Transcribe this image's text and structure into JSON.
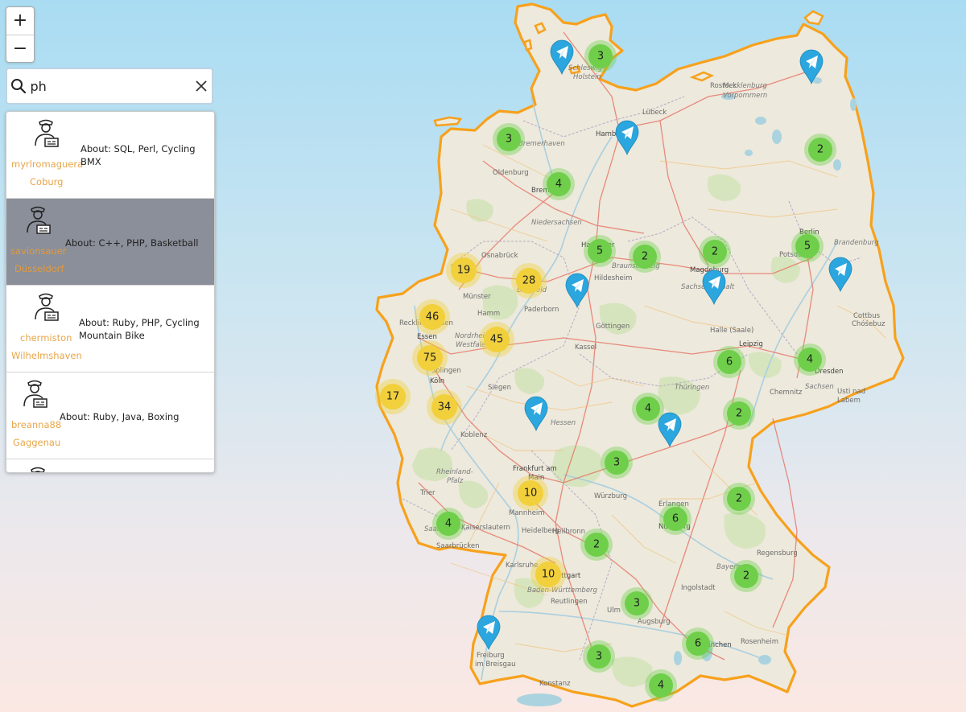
{
  "controls": {
    "zoom_in": "+",
    "zoom_out": "−"
  },
  "search": {
    "value": "ph",
    "icon": "search-icon",
    "clear_icon": "close-icon"
  },
  "results": [
    {
      "username": "myrlromaguera",
      "city": "Coburg",
      "about": "About: SQL, Perl, Cycling BMX",
      "selected": false
    },
    {
      "username": "savionsauer",
      "city": "Düsseldorf",
      "about": "About: C++, PHP, Basketball",
      "selected": true
    },
    {
      "username": "chermiston",
      "city": "Wilhelmshaven",
      "about": "About: Ruby, PHP, Cycling Mountain Bike",
      "selected": false
    },
    {
      "username": "breanna88",
      "city": "Gaggenau",
      "about": "About: Ruby, Java, Boxing",
      "selected": false
    }
  ],
  "map": {
    "country_border_color": "#f7a11c",
    "cluster_small_color": "#6fcf4a",
    "cluster_large_color": "#f1d03c",
    "marker_color": "#2ba6de",
    "marker_icon": "telegram-icon",
    "clusters": [
      {
        "count": "3",
        "size": "small"
      },
      {
        "count": "3",
        "size": "small"
      },
      {
        "count": "4",
        "size": "small"
      },
      {
        "count": "2",
        "size": "small"
      },
      {
        "count": "5",
        "size": "small"
      },
      {
        "count": "2",
        "size": "small"
      },
      {
        "count": "2",
        "size": "small"
      },
      {
        "count": "5",
        "size": "small"
      },
      {
        "count": "19",
        "size": "large"
      },
      {
        "count": "28",
        "size": "large"
      },
      {
        "count": "46",
        "size": "large"
      },
      {
        "count": "45",
        "size": "large"
      },
      {
        "count": "75",
        "size": "large"
      },
      {
        "count": "6",
        "size": "small"
      },
      {
        "count": "4",
        "size": "small"
      },
      {
        "count": "17",
        "size": "large"
      },
      {
        "count": "34",
        "size": "large"
      },
      {
        "count": "4",
        "size": "small"
      },
      {
        "count": "2",
        "size": "small"
      },
      {
        "count": "3",
        "size": "small"
      },
      {
        "count": "10",
        "size": "large"
      },
      {
        "count": "6",
        "size": "small"
      },
      {
        "count": "2",
        "size": "small"
      },
      {
        "count": "4",
        "size": "small"
      },
      {
        "count": "2",
        "size": "small"
      },
      {
        "count": "10",
        "size": "large"
      },
      {
        "count": "2",
        "size": "small"
      },
      {
        "count": "3",
        "size": "small"
      },
      {
        "count": "6",
        "size": "small"
      },
      {
        "count": "3",
        "size": "small"
      },
      {
        "count": "4",
        "size": "small"
      }
    ],
    "labels": [
      "Schleswig-",
      "Holstein",
      "Rostock",
      "Mecklenburg",
      "Vorpommern",
      "Hamb",
      "Lübeck",
      "Bremerhaven",
      "Oldenburg",
      "Bremen",
      "Niedersachsen",
      "Berlin",
      "Potsdam",
      "Brandenburg",
      "Osnabrück",
      "Hannover",
      "Braunschweig",
      "Magdeburg",
      "Sachsen-Anhalt",
      "Hildesheim",
      "Münster",
      "Bielefeld",
      "Paderborn",
      "Hamm",
      "Recklinghausen",
      "Essen",
      "Nordrhein-",
      "Westfalen",
      "Göttingen",
      "Halle (Saale)",
      "Leipzig",
      "Cottbus",
      "Chóśebuz",
      "Dresden",
      "Sachsen",
      "Kassel",
      "Chemnitz",
      "Solingen",
      "Köln",
      "Siegen",
      "Thüringen",
      "Hessen",
      "Koblenz",
      "Frankfurt am",
      "Main",
      "Rheinland-",
      "Pfalz",
      "Trier",
      "Würzburg",
      "Erlangen",
      "Nürnberg",
      "Mannheim",
      "Heidelberg",
      "Kaiserslautern",
      "Saarland",
      "Saarbrücken",
      "Heilbronn",
      "Bayern",
      "Ingolstadt",
      "Karlsruhe",
      "Stuttgart",
      "Baden-Württemberg",
      "Reutlingen",
      "Ulm",
      "Augsburg",
      "München",
      "Freiburg",
      "im Breisgau",
      "Usti nad",
      "Labem",
      "Rosenheim",
      "Regensburg",
      "Konstanz"
    ]
  }
}
